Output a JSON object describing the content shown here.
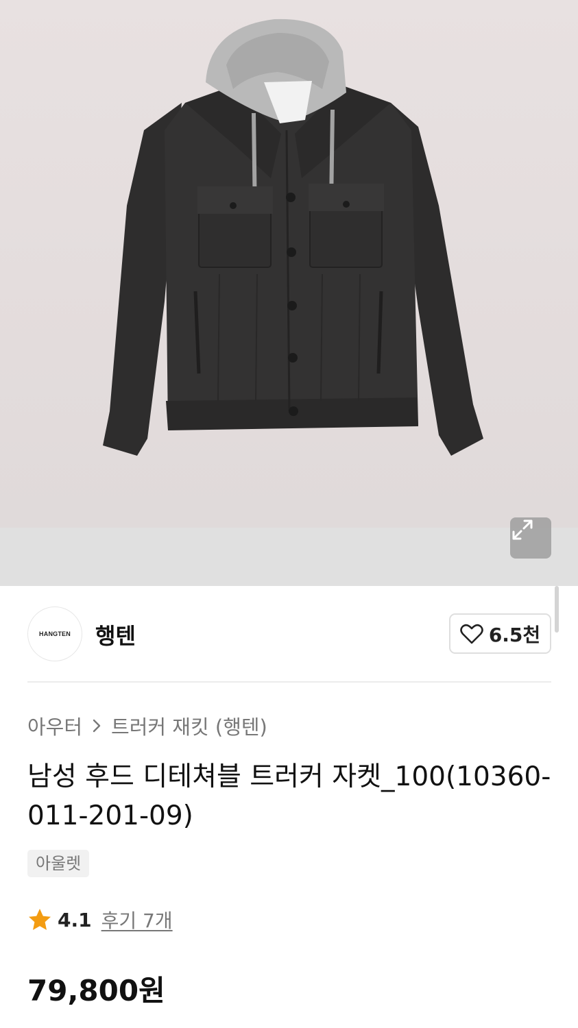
{
  "product_image": {
    "alt": ""
  },
  "brand": {
    "logo_text": "HANGTEN",
    "name": "행텐",
    "likes": "6.5천"
  },
  "breadcrumb": {
    "category": "아우터",
    "subcategory": "트러커 재킷 (행텐)"
  },
  "product": {
    "title": "남성 후드 디테쳐블 트러커 자켓_100(10360-011-201-09)",
    "tag": "아울렛",
    "rating": "4.1",
    "reviews": "후기 7개",
    "price": "79,800원"
  },
  "icons": [
    "expand-icon",
    "heart-icon",
    "chevron-right-icon",
    "star-icon"
  ],
  "colors": {
    "star": "#f39c12",
    "text": "#111111",
    "muted": "#777777"
  }
}
